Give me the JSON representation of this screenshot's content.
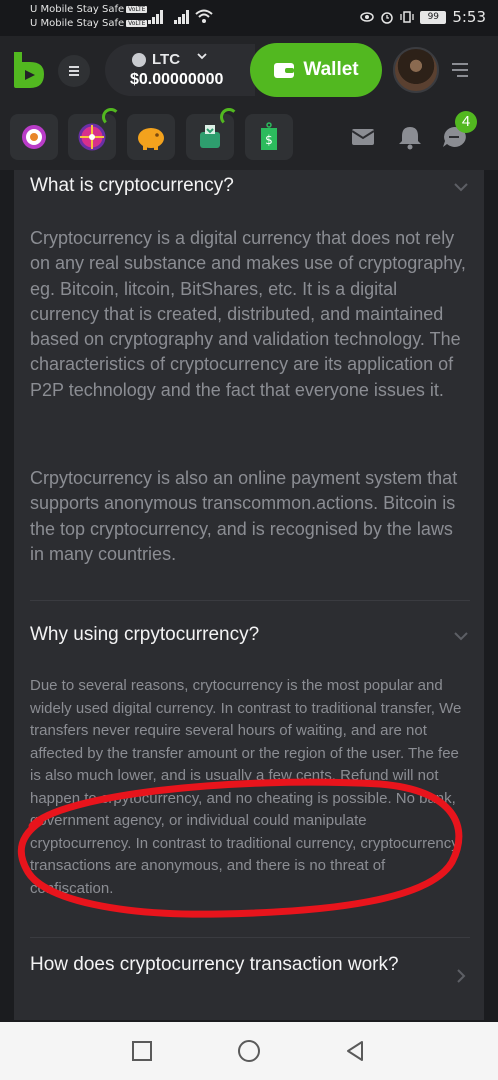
{
  "status_bar": {
    "carrier_1": "U Mobile Stay Safe",
    "carrier_2": "U Mobile Stay Safe",
    "volte": "VoLTE",
    "battery": "99",
    "time": "5:53"
  },
  "header": {
    "currency": "LTC",
    "balance": "$0.00000000",
    "wallet_label": "Wallet"
  },
  "quick_actions": [
    {
      "icon": "target-icon"
    },
    {
      "icon": "lucky-wheel-icon"
    },
    {
      "icon": "piggy-bank-icon"
    },
    {
      "icon": "vault-icon"
    },
    {
      "icon": "price-tag-icon"
    }
  ],
  "notifications": {
    "chat_badge": "4"
  },
  "faq": {
    "q1": {
      "title": "What is cryptocurrency?",
      "p1": "Cryptocurrency is a digital currency that does not rely on any real substance and makes use of cryptography, eg. Bitcoin, litcoin, BitShares, etc. It is a digital currency that is created, distributed, and maintained based on cryptography and validation technology. The characteristics of cryptocurrency are its application of P2P technology and the fact that everyone issues it.",
      "p2": "Crpytocurrency is also an online payment system that supports anonymous transcommon.actions. Bitcoin is the top cryptocurrency, and is recognised by the laws in many countries."
    },
    "q2": {
      "title": "Why using crpytocurrency?",
      "p1": "Due to several reasons, crytocurrency is the most popular and widely used digital currency. In contrast to traditional transfer, We transfers never require several hours of waiting, and are not affected by the transfer amount or the region of the user. The fee is also much lower, and is usually a few cents. Refund will not happen to crpytocurrency, and no cheating is possible. No bank, government agency, or individual could manipulate cryptocurrency. In contrast to traditional currency, cryptocurrency transactions are anonymous, and there is no threat of confiscation."
    },
    "q3": {
      "title": "How does cryptocurrency transaction work?"
    }
  },
  "colors": {
    "accent_green": "#52b820",
    "annotation_red": "#e8141c",
    "card_bg": "#2c2d31",
    "body_text": "#8b8d93"
  }
}
